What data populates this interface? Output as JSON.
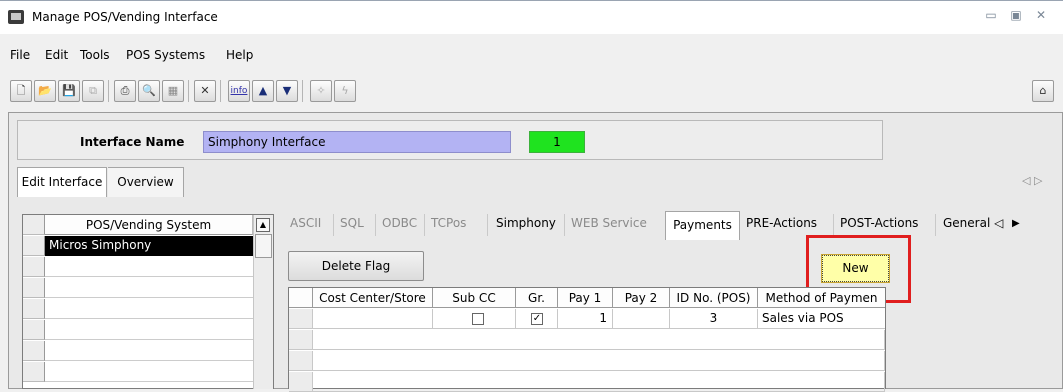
{
  "window": {
    "title": "Manage POS/Vending Interface",
    "controls": [
      "▭",
      "▣",
      "✕"
    ]
  },
  "menu": [
    "File",
    "Edit",
    "Tools",
    "POS Systems",
    "Help"
  ],
  "toolbar": {
    "info": "info",
    "home_icon": "home-icon"
  },
  "interface": {
    "label": "Interface Name",
    "value": "Simphony Interface",
    "status": "1"
  },
  "tabs": [
    "Edit Interface",
    "Overview"
  ],
  "tab_scroll": "◁ ▷",
  "pos_list": {
    "header": "POS/Vending System",
    "items": [
      "Micros Simphony"
    ]
  },
  "sub_tabs": [
    "ASCII",
    "SQL",
    "ODBC",
    "TCPos",
    "Simphony",
    "WEB Service",
    "Payments",
    "PRE-Actions",
    "POST-Actions",
    "General ◁"
  ],
  "sub_tab_arrow": "▶",
  "buttons": {
    "delete_flag": "Delete Flag",
    "new": "New"
  },
  "payments": {
    "columns": [
      "Cost Center/Store",
      "Sub CC",
      "Gr.",
      "Pay 1",
      "Pay 2",
      "ID No. (POS)",
      "Method of Paymen"
    ],
    "row": {
      "cost_center": "",
      "sub_cc": false,
      "gr": true,
      "pay1": "1",
      "pay2": "",
      "id_no": "3",
      "method": "Sales via POS"
    }
  },
  "colors": {
    "highlight": "#e01e1e",
    "status_green": "#1fe31f",
    "input_purple": "#b3b3f3",
    "new_button": "#ffffa8"
  }
}
